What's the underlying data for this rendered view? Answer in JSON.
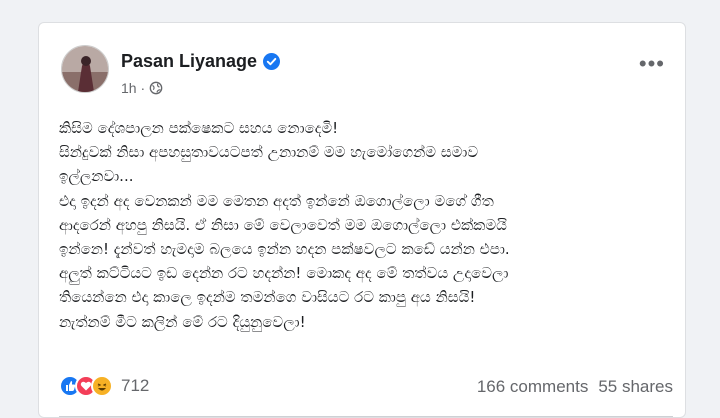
{
  "post": {
    "author": "Pasan Liyanage",
    "time": "1h ·",
    "text": "කිසිම දේශපාලන පක්ෂෙකට සහය නොදෙමි!\nසින්දුවක් නිසා අපහසුතාවයටපත් උනානම් මම හැමෝගෙන්ම සමාව\nඉල්ලනවා...\nඑදා ඉදන් අද වෙනකන් මම මෙතන අදත් ඉන්නේ ඔගොල්ලො මගේ ගීත\nආදරෙන් අහපු නිසයි. ඒ නිසා මේ වෙලාවෙත් මම ඔගොල්ලො එක්කමයි\nඉන්නෙ! දැන්වත් හැමදාම බලයෙ ඉන්න හදන පක්ෂවලට කඩේ යන්න එපා.\nඅලුත් කට්ටියට ඉඩ දෙන්න රට හදන්න! මොකද අද මේ තත්වය උදාවෙලා\nතියෙන්නෙ එදා කාලෙ ඉදන්ම තමන්ගෙ වාසියට රට කාපු අය නිසයි!\nනැත්නම් මීට කලින් මේ රට දියුනුවෙලා!"
  },
  "reactions": {
    "icons": [
      "like-icon",
      "love-icon",
      "haha-icon"
    ],
    "count": "712"
  },
  "stats": {
    "comments": "166 comments",
    "shares": "55 shares"
  },
  "colors": {
    "like": "#1877f2",
    "love": "#f33e58",
    "haha": "#f7b125",
    "verified": "#1877f2"
  }
}
